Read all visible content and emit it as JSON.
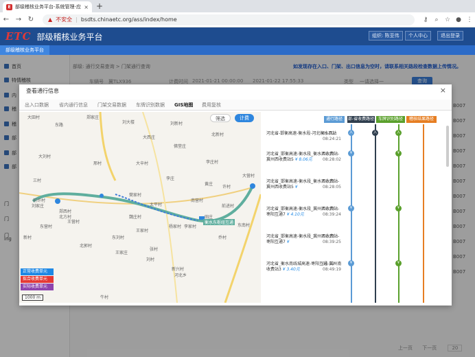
{
  "browser": {
    "tab_title": "部级稽核业务平台-系统管理-应...",
    "url_warning": "不安全",
    "url": "bsdts.chinaetc.org/ass/index/home"
  },
  "app": {
    "logo": "ETC",
    "title": "部级稽核业务平台",
    "header_buttons": [
      "组织: 陈亚伟",
      "个人中心",
      "退出登录"
    ],
    "subtab": "部级稽核业务平台"
  },
  "sidebar": {
    "items": [
      "首页",
      "特情稽核",
      "内",
      "稽",
      "稽",
      "部",
      "部",
      "部",
      "门",
      "门",
      "门",
      "ing"
    ]
  },
  "page": {
    "breadcrumb": "部级: 通行交易查询 > 门架通行查询",
    "notice": "如发现存在入口、门架、出口信息为空时，请联系相关路段检查数据上传情况。",
    "filters": {
      "plate_label": "车辆号",
      "plate_value": "冀TLX936",
      "time_label": "计费时间",
      "time_from": "2021-01-21 00:00:00",
      "time_to": "2021-01-22 17:55:33",
      "type_label": "类型",
      "type_value": "一请选择一",
      "query_button": "查询"
    },
    "right_col": [
      "B007",
      "B007",
      "B007",
      "B007",
      "B007",
      "B007",
      "B007",
      "B007",
      "B007",
      "B007",
      "B007",
      "B007"
    ],
    "pager": {
      "prev": "上一页",
      "next": "下一页",
      "size": "20"
    }
  },
  "modal": {
    "title": "查看通行信息",
    "close": "×",
    "tabs": [
      "出入口数据",
      "省内通行信息",
      "门架交易数据",
      "车牌识别数据",
      "GIS地图",
      "费用复核"
    ],
    "active_tab": "GIS地图",
    "map": {
      "filter_btn": "筛选",
      "calc_btn": "计费",
      "places": [
        "大田村",
        "东路",
        "郑家庄",
        "刘大楼",
        "刘新村",
        "大西庄",
        "佛堂庄",
        "北新村",
        "大刘村",
        "邢村",
        "大辛村",
        "李庄村",
        "李庄",
        "大营村",
        "三村",
        "黄庄",
        "南营村",
        "刘家庄",
        "郑西村",
        "北方村",
        "东营村",
        "王营村",
        "太平村",
        "魏庄村",
        "李家村",
        "王家村",
        "杨家村",
        "前进村",
        "田庄",
        "乔村",
        "张村",
        "王家庄",
        "刘村",
        "河北乡",
        "新兴村",
        "牛村",
        "东刘村",
        "前许村",
        "樊家村",
        "东南村",
        "北郭村",
        "许村",
        "新村"
      ],
      "highway_label": "衡水东枢纽互通",
      "legend": [
        "正常收费单元",
        "拟合收费单元",
        "实际收费单元"
      ],
      "scale": "1000 m"
    },
    "route_headers": [
      "通行路径",
      "部-省收费路径",
      "车牌识别路径",
      "稽核结果路径"
    ],
    "route_colors": [
      "#5b9bd5",
      "#2f3e4e",
      "#5aa02c",
      "#e67e22"
    ],
    "legend_colors": [
      "#1e88e5",
      "#e53935",
      "#8e44ad"
    ],
    "route_items": [
      {
        "text": "河北省-邯衡高速-衡水段-河北衡水西站",
        "fee": "",
        "date": "01-22",
        "time": "08:24:21",
        "badge": "入"
      },
      {
        "text": "河北省_邯衡高速-衡水段_衡水西收费站-冀州西收费站5",
        "fee": "¥ 8.06元",
        "date": "01-22",
        "time": "08:28:02",
        "badge": "¥"
      },
      {
        "text": "河北省_邯衡高速-衡水段_衡水西收费站-冀州西收费站5",
        "fee": "¥",
        "date": "01-22",
        "time": "08:28:05",
        "badge": ""
      },
      {
        "text": "河北省_邯衡高速-衡水段_冀州西收费站-枣阳互通7",
        "fee": "¥ 4.10元",
        "date": "01-22",
        "time": "08:39:24",
        "badge": "¥"
      },
      {
        "text": "河北省_邯衡高速-衡水段_冀州西收费站-枣阳互通7",
        "fee": "¥",
        "date": "01-22",
        "time": "08:39:25",
        "badge": ""
      },
      {
        "text": "河北省_衡水南线城高速-枣阳互通-冀州南收费站3",
        "fee": "¥ 3.40元",
        "date": "01-22",
        "time": "08:49:19",
        "badge": "¥"
      }
    ]
  }
}
